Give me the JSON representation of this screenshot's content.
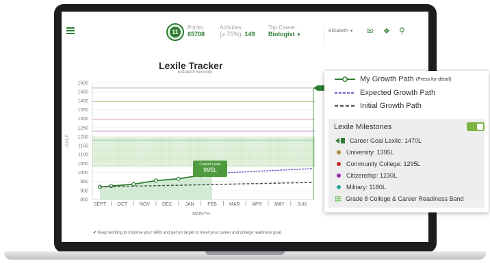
{
  "header": {
    "level": "11",
    "points_label": "Points:",
    "points_value": "65708",
    "activities_label": "Activities",
    "activities_qualifier": "(≥ 75%):",
    "activities_value": "149",
    "career_label": "Top Career:",
    "career_value": "Biologist",
    "user_name": "Elizabeth"
  },
  "chart": {
    "title": "Lexile Tracker",
    "subtitle": "Elizabeth Kennedy",
    "ylabel": "LEXILE",
    "xlabel": "MONTH",
    "current_label": "Current Lexile",
    "current_value": "995L",
    "footer": "Keep working to improve your skills and get on target to meet your career and college readiness goal."
  },
  "chart_data": {
    "type": "line",
    "title": "Lexile Tracker",
    "xlabel": "MONTH",
    "ylabel": "LEXILE",
    "categories": [
      "SEPT",
      "OCT",
      "NOV",
      "DEC",
      "JAN",
      "FEB",
      "MAR",
      "APR",
      "MAY",
      "JUN"
    ],
    "yticks": [
      850,
      900,
      950,
      1000,
      1050,
      1100,
      1150,
      1200,
      1250,
      1300,
      1350,
      1400,
      1450,
      1500
    ],
    "ylim": [
      850,
      1500
    ],
    "series": [
      {
        "name": "My Growth Path",
        "x": [
          0.0,
          0.5,
          1.5,
          2.5,
          3.5,
          4.5,
          5.0
        ],
        "values": [
          920,
          925,
          935,
          955,
          965,
          985,
          995
        ],
        "color": "#2e7d32",
        "style": "solid"
      },
      {
        "name": "Expected Growth Path",
        "x": [
          5.0,
          9.5
        ],
        "values": [
          995,
          1022
        ],
        "color": "#7b68c8",
        "style": "dotted"
      },
      {
        "name": "Initial Growth Path",
        "x": [
          0.0,
          9.5
        ],
        "values": [
          920,
          945
        ],
        "color": "#555555",
        "style": "dashed"
      }
    ],
    "milestones": [
      {
        "value": 1470,
        "color": "#2e7d32"
      },
      {
        "value": 1395,
        "color": "#a98c34"
      },
      {
        "value": 1295,
        "color": "#c62828"
      },
      {
        "value": 1230,
        "color": "#9c27b0"
      },
      {
        "value": 1180,
        "color": "#26a69a"
      }
    ],
    "band": [
      1030,
      1200
    ],
    "grid": true
  },
  "legend": {
    "my_growth": "My Growth Path",
    "my_growth_note": "(Press for detail)",
    "expected": "Expected Growth Path",
    "initial": "Initial Growth Path",
    "milestones_title": "Lexile Milestones",
    "milestones": [
      {
        "label": "Career Goal Lexile: 1470L",
        "color": "#2e7d32",
        "icon": "flag-icon"
      },
      {
        "label": "University: 1395L",
        "color": "#a98c34",
        "icon": "dot"
      },
      {
        "label": "Community College: 1295L",
        "color": "#c62828",
        "icon": "dot"
      },
      {
        "label": "Citizenship: 1230L",
        "color": "#9c27b0",
        "icon": "dot"
      },
      {
        "label": "Military: 1180L",
        "color": "#26a69a",
        "icon": "dot"
      },
      {
        "label": "Grade 8 College & Career Readiness Band",
        "color": "#a5d6a7",
        "icon": "band-swatch"
      }
    ]
  }
}
